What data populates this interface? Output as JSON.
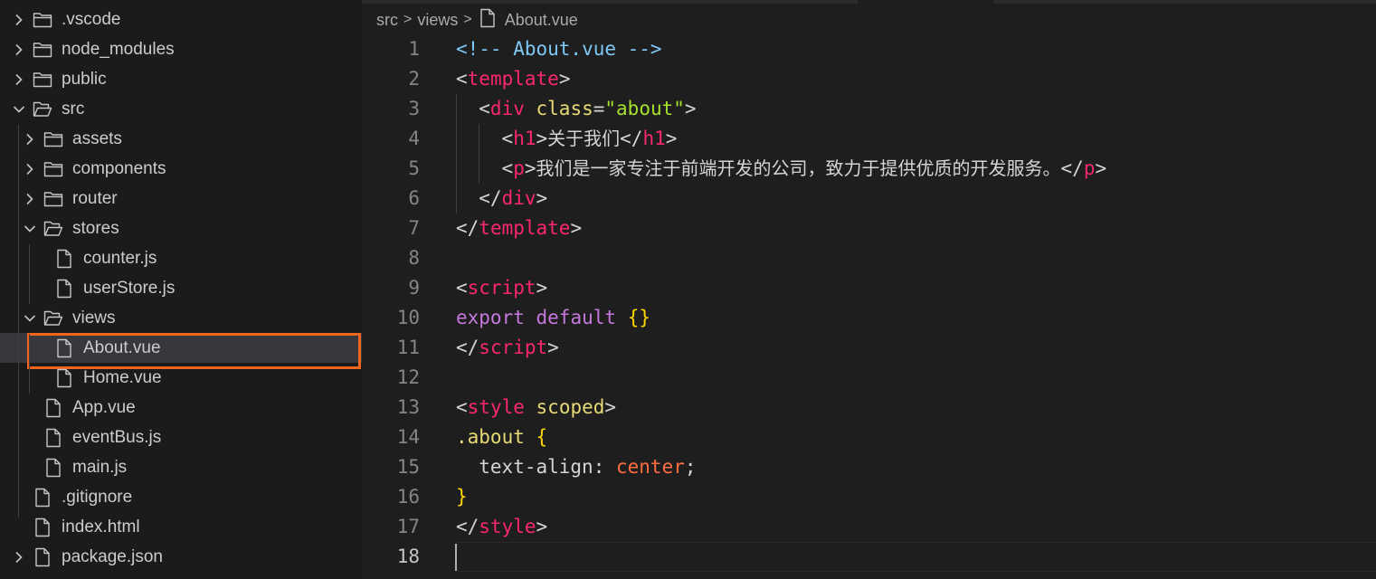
{
  "explorer": {
    "items": [
      {
        "label": ".vscode",
        "type": "folder",
        "depth": 0,
        "expanded": false
      },
      {
        "label": "node_modules",
        "type": "folder",
        "depth": 0,
        "expanded": false
      },
      {
        "label": "public",
        "type": "folder",
        "depth": 0,
        "expanded": false
      },
      {
        "label": "src",
        "type": "folder",
        "depth": 0,
        "expanded": true
      },
      {
        "label": "assets",
        "type": "folder",
        "depth": 1,
        "expanded": false
      },
      {
        "label": "components",
        "type": "folder",
        "depth": 1,
        "expanded": false
      },
      {
        "label": "router",
        "type": "folder",
        "depth": 1,
        "expanded": false
      },
      {
        "label": "stores",
        "type": "folder",
        "depth": 1,
        "expanded": true
      },
      {
        "label": "counter.js",
        "type": "file",
        "depth": 2
      },
      {
        "label": "userStore.js",
        "type": "file",
        "depth": 2
      },
      {
        "label": "views",
        "type": "folder",
        "depth": 1,
        "expanded": true
      },
      {
        "label": "About.vue",
        "type": "file",
        "depth": 2,
        "selected": true
      },
      {
        "label": "Home.vue",
        "type": "file",
        "depth": 2
      },
      {
        "label": "App.vue",
        "type": "file",
        "depth": 1
      },
      {
        "label": "eventBus.js",
        "type": "file",
        "depth": 1
      },
      {
        "label": "main.js",
        "type": "file",
        "depth": 1
      },
      {
        "label": ".gitignore",
        "type": "file",
        "depth": 0
      },
      {
        "label": "index.html",
        "type": "file",
        "depth": 0
      },
      {
        "label": "package.json",
        "type": "file",
        "depth": 0,
        "chevron": true
      }
    ],
    "highlight_color": "#f0641e"
  },
  "breadcrumb": {
    "parts": [
      "src",
      "views",
      "About.vue"
    ],
    "separator": ">"
  },
  "editor": {
    "current_line": 18,
    "lines": [
      {
        "n": "1",
        "indent": 0,
        "tokens": [
          [
            "cm",
            "<!-- About.vue -->"
          ]
        ]
      },
      {
        "n": "2",
        "indent": 0,
        "tokens": [
          [
            "br",
            "<"
          ],
          [
            "tag",
            "template"
          ],
          [
            "br",
            ">"
          ]
        ]
      },
      {
        "n": "3",
        "indent": 1,
        "tokens": [
          [
            "br",
            "<"
          ],
          [
            "tag",
            "div"
          ],
          [
            "txt",
            " "
          ],
          [
            "attr",
            "class"
          ],
          [
            "br",
            "="
          ],
          [
            "str",
            "\"about\""
          ],
          [
            "br",
            ">"
          ]
        ]
      },
      {
        "n": "4",
        "indent": 2,
        "tokens": [
          [
            "br",
            "<"
          ],
          [
            "tag",
            "h1"
          ],
          [
            "br",
            ">"
          ],
          [
            "cjk",
            "关于我们"
          ],
          [
            "br",
            "</"
          ],
          [
            "tag",
            "h1"
          ],
          [
            "br",
            ">"
          ]
        ]
      },
      {
        "n": "5",
        "indent": 2,
        "tokens": [
          [
            "br",
            "<"
          ],
          [
            "tag",
            "p"
          ],
          [
            "br",
            ">"
          ],
          [
            "cjk",
            "我们是一家专注于前端开发的公司，致力于提供优质的开发服务。"
          ],
          [
            "br",
            "</"
          ],
          [
            "tag",
            "p"
          ],
          [
            "br",
            ">"
          ]
        ]
      },
      {
        "n": "6",
        "indent": 1,
        "tokens": [
          [
            "br",
            "</"
          ],
          [
            "tag",
            "div"
          ],
          [
            "br",
            ">"
          ]
        ]
      },
      {
        "n": "7",
        "indent": 0,
        "tokens": [
          [
            "br",
            "</"
          ],
          [
            "tag",
            "template"
          ],
          [
            "br",
            ">"
          ]
        ]
      },
      {
        "n": "8",
        "indent": 0,
        "tokens": []
      },
      {
        "n": "9",
        "indent": 0,
        "tokens": [
          [
            "br",
            "<"
          ],
          [
            "tag",
            "script"
          ],
          [
            "br",
            ">"
          ]
        ]
      },
      {
        "n": "10",
        "indent": 0,
        "tokens": [
          [
            "kw",
            "export"
          ],
          [
            "txt",
            " "
          ],
          [
            "kw",
            "default"
          ],
          [
            "txt",
            " "
          ],
          [
            "cur",
            "{}"
          ]
        ]
      },
      {
        "n": "11",
        "indent": 0,
        "tokens": [
          [
            "br",
            "</"
          ],
          [
            "tag",
            "script"
          ],
          [
            "br",
            ">"
          ]
        ]
      },
      {
        "n": "12",
        "indent": 0,
        "tokens": []
      },
      {
        "n": "13",
        "indent": 0,
        "tokens": [
          [
            "br",
            "<"
          ],
          [
            "tag",
            "style"
          ],
          [
            "txt",
            " "
          ],
          [
            "attr",
            "scoped"
          ],
          [
            "br",
            ">"
          ]
        ]
      },
      {
        "n": "14",
        "indent": 0,
        "tokens": [
          [
            "cls",
            ".about"
          ],
          [
            "txt",
            " "
          ],
          [
            "cur",
            "{"
          ]
        ]
      },
      {
        "n": "15",
        "indent": 1,
        "tokens": [
          [
            "txt",
            "text-align"
          ],
          [
            "txt",
            ": "
          ],
          [
            "val",
            "center"
          ],
          [
            "txt",
            ";"
          ]
        ]
      },
      {
        "n": "16",
        "indent": 0,
        "tokens": [
          [
            "cur",
            "}"
          ]
        ]
      },
      {
        "n": "17",
        "indent": 0,
        "tokens": [
          [
            "br",
            "</"
          ],
          [
            "tag",
            "style"
          ],
          [
            "br",
            ">"
          ]
        ]
      },
      {
        "n": "18",
        "indent": 0,
        "tokens": []
      }
    ]
  },
  "colors": {
    "background": "#1e1e1e",
    "sidebar": "#1b1b1b",
    "selection": "#37373d",
    "tag": "#f92672",
    "attribute": "#e6db74",
    "string": "#a6e22e",
    "keyword": "#c678dd",
    "comment": "#7fc8f6"
  }
}
